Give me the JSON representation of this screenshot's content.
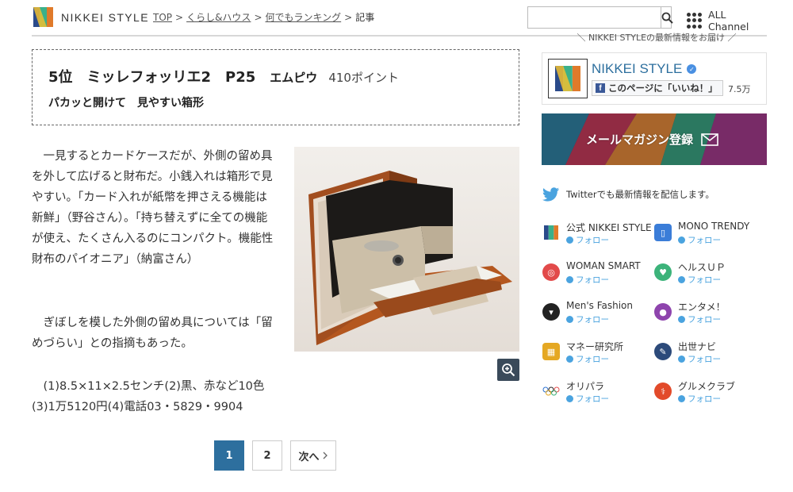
{
  "header": {
    "logo_text": "NIKKEI STYLE",
    "breadcrumb": [
      {
        "label": "TOP",
        "link": true
      },
      {
        "label": "くらし&ハウス",
        "link": true
      },
      {
        "label": "何でもランキング",
        "link": true
      },
      {
        "label": "記事",
        "link": false
      }
    ],
    "search_placeholder": "",
    "all_channel": "ALL Channel"
  },
  "article": {
    "rank": "5位",
    "name": "ミッレフォッリエ2　P25",
    "brand": "エムピウ",
    "points": "410ポイント",
    "subtitle": "パカッと開けて　見やすい箱形",
    "paragraph1": "一見するとカードケースだが、外側の留め具を外して広げると財布だ。小銭入れは箱形で見やすい。「カード入れが紙幣を押さえる機能は新鮮」（野谷さん）。「持ち替えずに全ての機能が使え、たくさん入るのにコンパクト。機能性財布のパイオニア」（納富さん）",
    "paragraph2": "ぎぼしを模した外側の留め具については「留めづらい」との指摘もあった。",
    "paragraph3": "(1)8.5×11×2.5センチ(2)黒、赤など10色(3)1万5120円(4)電話03・5829・9904"
  },
  "pager": {
    "pages": [
      "1",
      "2"
    ],
    "active": "1",
    "next": "次へ"
  },
  "sidebar": {
    "promo": "NIKKEI STYLEの最新情報をお届け",
    "fb_name": "NIKKEI STYLE",
    "fb_like": "このページに「いいね！」",
    "fb_count": "7.5万",
    "mail_banner": "メールマガジン登録",
    "twitter_text": "Twitterでも最新情報を配信します。",
    "follow_label": "フォロー",
    "channels": [
      {
        "name": "公式 NIKKEI STYLE",
        "icon": "nikkei-logo-icon",
        "color": "#ffffff"
      },
      {
        "name": "MONO TRENDY",
        "icon": "mono-trendy-icon",
        "color": "#3b7dd8"
      },
      {
        "name": "WOMAN SMART",
        "icon": "woman-smart-icon",
        "color": "#e24a4a"
      },
      {
        "name": "ヘルスＵＰ",
        "icon": "health-up-icon",
        "color": "#3cb37a"
      },
      {
        "name": "Men's Fashion",
        "icon": "mens-fashion-icon",
        "color": "#222222"
      },
      {
        "name": "エンタメ！",
        "icon": "entame-icon",
        "color": "#8e44ad"
      },
      {
        "name": "マネー研究所",
        "icon": "money-icon",
        "color": "#e5a823"
      },
      {
        "name": "出世ナビ",
        "icon": "shusse-navi-icon",
        "color": "#2c4a7a"
      },
      {
        "name": "オリパラ",
        "icon": "olympic-icon",
        "color": "#ffffff"
      },
      {
        "name": "グルメクラブ",
        "icon": "gourmet-icon",
        "color": "#e24a2a"
      }
    ]
  }
}
